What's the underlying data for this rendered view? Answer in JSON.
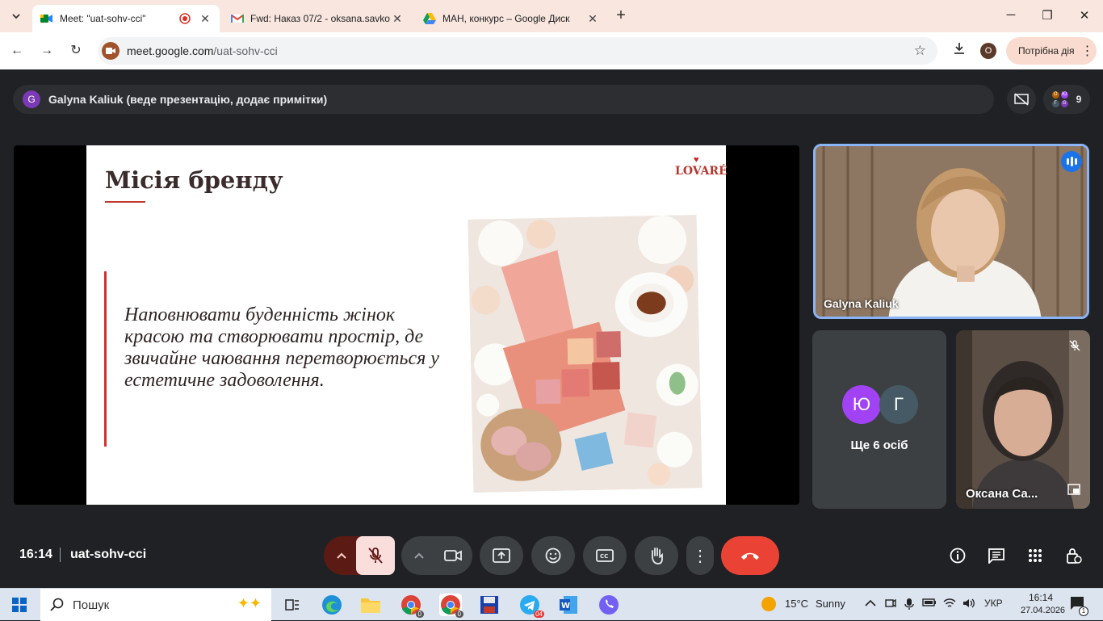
{
  "browser": {
    "tabs": [
      {
        "title": "Meet: \"uat-sohv-cci\"",
        "active": true,
        "recording": true
      },
      {
        "title": "Fwd: Наказ 07/2 - oksana.savko",
        "active": false
      },
      {
        "title": "МАН, конкурс – Google Диск",
        "active": false
      }
    ],
    "url_host": "meet.google.com",
    "url_path": "/uat-sohv-cci",
    "profile_initial": "O",
    "action_button": "Потрібна дія"
  },
  "meet": {
    "presenter_initial": "G",
    "presenter_text": "Galyna Kaliuk (веде презентацію, додає примітки)",
    "participants_count": "9",
    "participant_avatar_letters": [
      "O",
      "Ю",
      "Г",
      "G"
    ],
    "slide": {
      "title": "Місія бренду",
      "logo": "LOVARÉ",
      "quote": "Наповнювати буденність жінок красою та створювати простір, де звичайне чаювання перетворюється у естетичне задоволення."
    },
    "tiles": {
      "speaker_name": "Galyna Kaliuk",
      "others_initials": [
        "Ю",
        "Г"
      ],
      "others_label": "Ще 6 осіб",
      "self_name": "Оксана Са..."
    },
    "time": "16:14",
    "meeting_code": "uat-sohv-cci"
  },
  "taskbar": {
    "search_placeholder": "Пошук",
    "weather_temp": "15°C",
    "weather_desc": "Sunny",
    "language": "УКР",
    "clock_time": "16:14",
    "clock_date": "27.04.2026",
    "notification_count": "1",
    "chrome_badge_1": "0",
    "chrome_badge_2": "0",
    "telegram_badge": "04"
  },
  "colors": {
    "meet_bg": "#202124",
    "end_call": "#ea4335",
    "mic_off_bg": "#f9dedc",
    "highlight": "#8ab4f8"
  }
}
